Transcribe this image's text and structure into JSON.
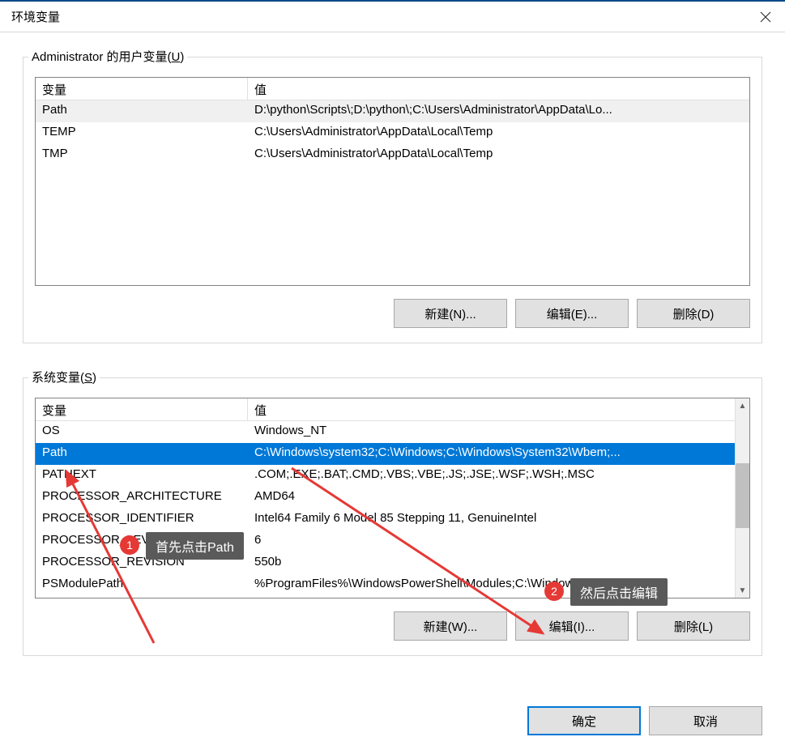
{
  "window": {
    "title": "环境变量"
  },
  "user_vars": {
    "group_label_prefix": "Administrator 的用户变量(",
    "group_label_key": "U",
    "group_label_suffix": ")",
    "header_var": "变量",
    "header_val": "值",
    "rows": [
      {
        "name": "Path",
        "value": "D:\\python\\Scripts\\;D:\\python\\;C:\\Users\\Administrator\\AppData\\Lo..."
      },
      {
        "name": "TEMP",
        "value": "C:\\Users\\Administrator\\AppData\\Local\\Temp"
      },
      {
        "name": "TMP",
        "value": "C:\\Users\\Administrator\\AppData\\Local\\Temp"
      }
    ],
    "btn_new": "新建(N)...",
    "btn_edit": "编辑(E)...",
    "btn_delete": "删除(D)"
  },
  "sys_vars": {
    "group_label_prefix": "系统变量(",
    "group_label_key": "S",
    "group_label_suffix": ")",
    "header_var": "变量",
    "header_val": "值",
    "rows": [
      {
        "name": "OS",
        "value": "Windows_NT"
      },
      {
        "name": "Path",
        "value": "C:\\Windows\\system32;C:\\Windows;C:\\Windows\\System32\\Wbem;..."
      },
      {
        "name": "PATHEXT",
        "value": ".COM;.EXE;.BAT;.CMD;.VBS;.VBE;.JS;.JSE;.WSF;.WSH;.MSC"
      },
      {
        "name": "PROCESSOR_ARCHITECTURE",
        "value": "AMD64"
      },
      {
        "name": "PROCESSOR_IDENTIFIER",
        "value": "Intel64 Family 6 Model 85 Stepping 11, GenuineIntel"
      },
      {
        "name": "PROCESSOR_LEVEL",
        "value": "6"
      },
      {
        "name": "PROCESSOR_REVISION",
        "value": "550b"
      },
      {
        "name": "PSModulePath",
        "value": "%ProgramFiles%\\WindowsPowerShell\\Modules;C:\\Windows\\syste"
      }
    ],
    "btn_new": "新建(W)...",
    "btn_edit": "编辑(I)...",
    "btn_delete": "删除(L)"
  },
  "footer": {
    "ok": "确定",
    "cancel": "取消"
  },
  "annotations": {
    "badge1": "1",
    "tip1": "首先点击Path",
    "badge2": "2",
    "tip2": "然后点击编辑"
  }
}
